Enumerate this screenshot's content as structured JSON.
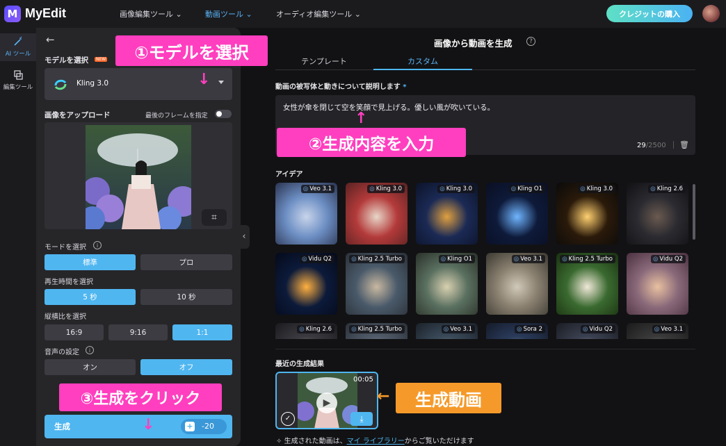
{
  "app": {
    "logo_letter": "M",
    "name": "MyEdit"
  },
  "nav": [
    {
      "label": "画像編集ツール",
      "caret": "⌄"
    },
    {
      "label": "動画ツール",
      "caret": "⌄"
    },
    {
      "label": "オーディオ編集ツール",
      "caret": "⌄"
    }
  ],
  "header": {
    "credit_button": "クレジットの購入"
  },
  "rail": [
    {
      "label": "AI ツール",
      "icon": "wand-icon"
    },
    {
      "label": "編集ツール",
      "icon": "layers-icon"
    }
  ],
  "left": {
    "back": "←",
    "model_label": "モデルを選択",
    "new_badge": "NEW",
    "model_value": "Kling 3.0",
    "upload_label": "画像をアップロード",
    "last_frame_label": "最後のフレームを指定",
    "mode_label": "モードを選択",
    "mode_options": [
      "標準",
      "プロ"
    ],
    "duration_label": "再生時間を選択",
    "duration_options": [
      "5 秒",
      "10 秒"
    ],
    "ratio_label": "縦横比を選択",
    "ratio_options": [
      "16:9",
      "9:16",
      "1:1"
    ],
    "audio_label": "音声の設定",
    "audio_options": [
      "オン",
      "オフ"
    ],
    "generate_label": "生成",
    "generate_cost": "-20"
  },
  "annotations": {
    "a1": "①モデルを選択",
    "a2": "②生成内容を入力",
    "a3": "③生成をクリック",
    "a4": "生成動画"
  },
  "main": {
    "title": "画像から動画を生成",
    "tabs": [
      "テンプレート",
      "カスタム"
    ],
    "prompt_label": "動画の被写体と動きについて説明します",
    "required_mark": "*",
    "prompt_text": "女性が傘を閉じて空を笑顔で見上げる。優しい風が吹いている。",
    "char_count": "29",
    "char_max": "/2500",
    "ideas_label": "アイデア",
    "ideas": [
      {
        "model": "Veo 3.1",
        "colors": [
          "#6d8fc4",
          "#c8d4ea",
          "#2a3350"
        ]
      },
      {
        "model": "Kling 3.0",
        "colors": [
          "#b33a3a",
          "#e8d6c8",
          "#5a2222"
        ]
      },
      {
        "model": "Kling 3.0",
        "colors": [
          "#1b2a55",
          "#e0a040",
          "#0c1228"
        ]
      },
      {
        "model": "Kling O1",
        "colors": [
          "#0e1a3a",
          "#6fb5ff",
          "#0a0f22"
        ]
      },
      {
        "model": "Kling 3.0",
        "colors": [
          "#2a1a0a",
          "#ffd070",
          "#0a0a0a"
        ]
      },
      {
        "model": "Kling 2.6",
        "colors": [
          "#2a2a30",
          "#6a5a50",
          "#111114"
        ]
      },
      {
        "model": "Vidu Q2",
        "colors": [
          "#0c1a3a",
          "#ffb040",
          "#050a1a"
        ]
      },
      {
        "model": "Kling 2.5 Turbo",
        "colors": [
          "#4a5a6a",
          "#c8b8a0",
          "#2a3038"
        ]
      },
      {
        "model": "Kling O1",
        "colors": [
          "#5a7060",
          "#d8d0b0",
          "#2a3028"
        ]
      },
      {
        "model": "Veo 3.1",
        "colors": [
          "#8a8070",
          "#d0c8b8",
          "#3a3830"
        ]
      },
      {
        "model": "Kling 2.5 Turbo",
        "colors": [
          "#3a6a30",
          "#f0e8d8",
          "#1a3010"
        ]
      },
      {
        "model": "Vidu Q2",
        "colors": [
          "#8a6a7a",
          "#e8c0a0",
          "#4a3040"
        ]
      },
      {
        "model": "Kling 2.6",
        "colors": [
          "#3a3a40",
          "#c8a890",
          "#1a1a1e"
        ]
      },
      {
        "model": "Kling 2.5 Turbo",
        "colors": [
          "#505a68",
          "#b0b8c8",
          "#2a3038"
        ]
      },
      {
        "model": "Veo 3.1",
        "colors": [
          "#3a4a5a",
          "#b0a090",
          "#1a2028"
        ]
      },
      {
        "model": "Sora 2",
        "colors": [
          "#2a3a5a",
          "#a0b0c8",
          "#141a28"
        ]
      },
      {
        "model": "Vidu Q2",
        "colors": [
          "#3a4050",
          "#c0c0c8",
          "#1a1c22"
        ]
      },
      {
        "model": "Veo 3.1",
        "colors": [
          "#3a3a3a",
          "#a8a8a8",
          "#1a1a1a"
        ]
      }
    ],
    "recent_label": "最近の生成結果",
    "recent_duration": "00:05",
    "footer_prefix": "生成された動画は、",
    "footer_link": "マイ ライブラリー",
    "footer_suffix": "からご覧いただけます"
  },
  "colors": {
    "accent": "#4fb6f0",
    "annotation_pink": "#ff3fbf",
    "annotation_orange": "#f59a2a"
  }
}
